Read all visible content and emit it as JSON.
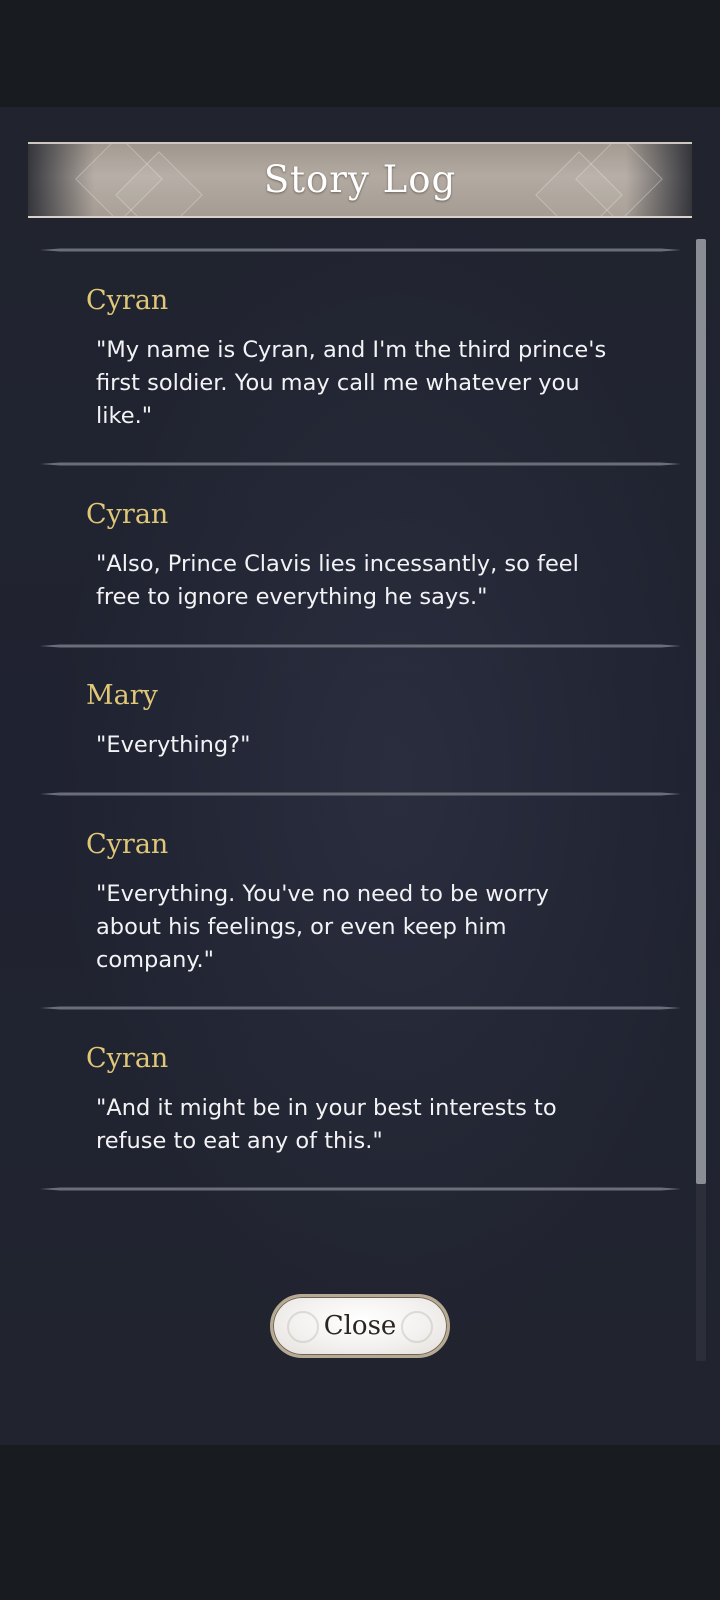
{
  "header": {
    "title": "Story Log"
  },
  "entries": [
    {
      "speaker": "Cyran",
      "lines": [
        "\"My name is Cyran, and I'm the third prince's",
        "first soldier. You may call me whatever you",
        "like.\""
      ]
    },
    {
      "speaker": "Cyran",
      "lines": [
        "\"Also, Prince Clavis lies incessantly, so feel",
        "free to ignore everything he says.\""
      ]
    },
    {
      "speaker": "Mary",
      "lines": [
        "\"Everything?\""
      ]
    },
    {
      "speaker": "Cyran",
      "lines": [
        "\"Everything. You've no need to be worry",
        "about his feelings, or even keep him",
        "company.\""
      ]
    },
    {
      "speaker": "Cyran",
      "lines": [
        "\"And it might be in your best interests to",
        "refuse to eat any of this.\""
      ]
    }
  ],
  "scroll": {
    "position": 0
  },
  "close_button": {
    "label": "Close"
  },
  "colors": {
    "speaker_name": "#dfc777",
    "dialogue_text": "#f3f3f5",
    "panel_background": "#21242f"
  }
}
